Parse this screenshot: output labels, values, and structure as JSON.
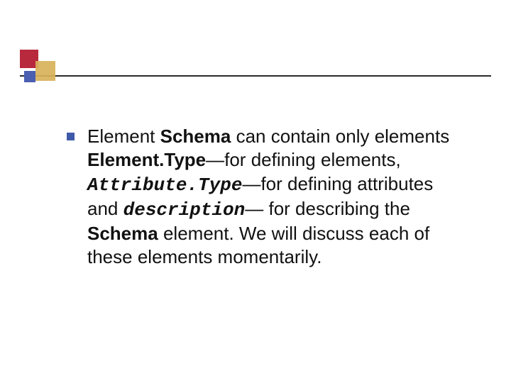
{
  "bullet": {
    "t1": "Element ",
    "t2": "Schema",
    "t3": " can contain only elements ",
    "t4": "Element.Type",
    "t5": "—for defining elements, ",
    "t6": "Attribute.Type",
    "t7": "—for defining attributes and ",
    "t8": "description",
    "t9": "— for describing the ",
    "t10": "Schema",
    "t11": " element. We will discuss each of these elements momentarily."
  }
}
